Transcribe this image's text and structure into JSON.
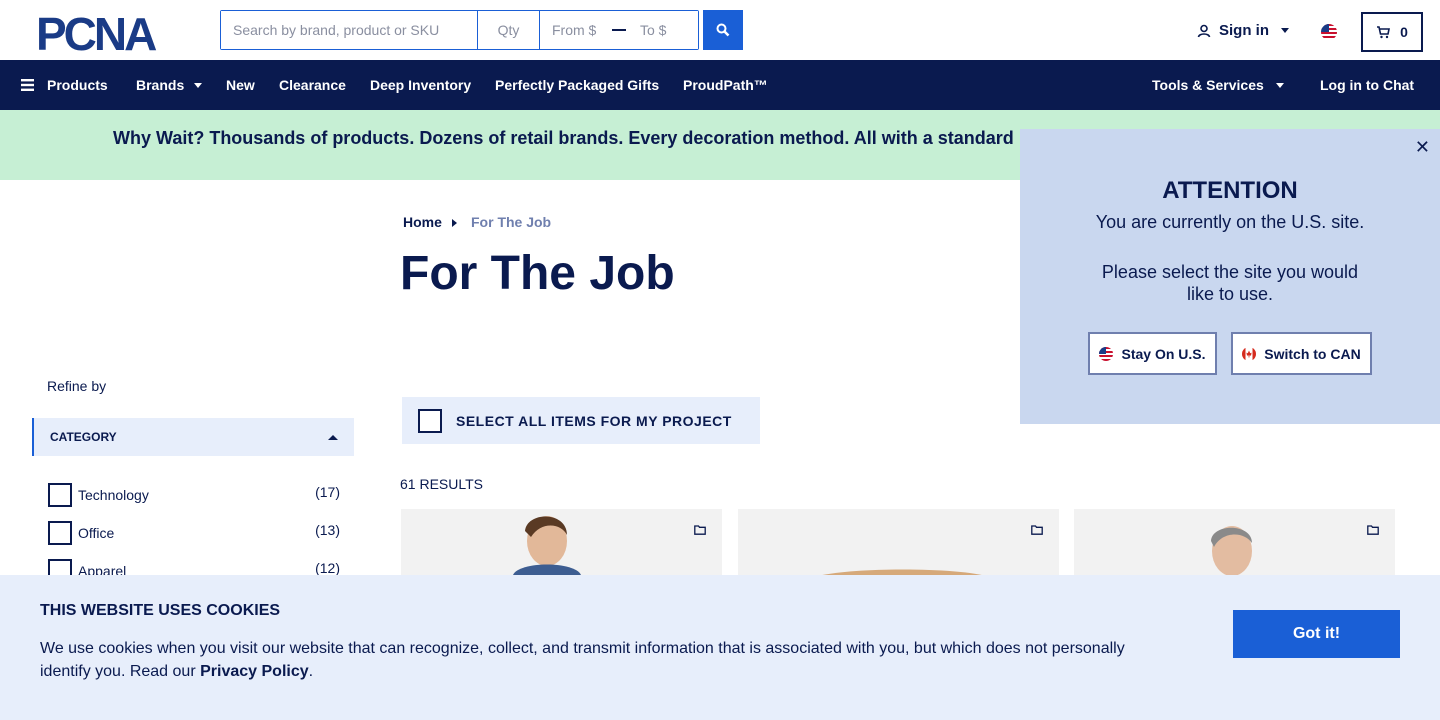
{
  "header": {
    "logo_text": "PCNA",
    "search": {
      "placeholder": "Search by brand, product or SKU",
      "qty_placeholder": "Qty",
      "from_placeholder": "From $",
      "to_placeholder": "To $"
    },
    "signin_label": "Sign in",
    "cart_count": "0"
  },
  "nav": {
    "products": "Products",
    "brands": "Brands",
    "new": "New",
    "clearance": "Clearance",
    "deep_inventory": "Deep Inventory",
    "gifts": "Perfectly Packaged Gifts",
    "proudpath": "ProudPath™",
    "tools": "Tools & Services",
    "chat": "Log in to Chat"
  },
  "promo": {
    "text": "Why Wait? Thousands of products. Dozens of retail brands. Every decoration method. All with a standard"
  },
  "breadcrumb": {
    "home": "Home",
    "current": "For The Job"
  },
  "page_title": "For The Job",
  "sidebar": {
    "refine_label": "Refine by",
    "category_header": "CATEGORY",
    "categories": [
      {
        "label": "Technology",
        "count": "(17)"
      },
      {
        "label": "Office",
        "count": "(13)"
      },
      {
        "label": "Apparel",
        "count": "(12)"
      }
    ]
  },
  "main": {
    "select_all_label": "SELECT ALL ITEMS FOR MY PROJECT",
    "results_label": "61 RESULTS"
  },
  "attention": {
    "title": "ATTENTION",
    "line1": "You are currently on the U.S. site.",
    "line2": "Please select the site you would like to use.",
    "stay_label": "Stay On U.S.",
    "switch_label": "Switch to CAN"
  },
  "cookie": {
    "title": "THIS WEBSITE USES COOKIES",
    "text": "We use cookies when you visit our website that can recognize, collect, and transmit information that is associated with you, but which does not personally identify you. Read our",
    "link": "Privacy Policy",
    "period": ".",
    "button": "Got it!"
  },
  "colors": {
    "navy": "#0a1a4f",
    "blue": "#1a5fd6",
    "promo_green": "#c6efd4",
    "popup_bg": "#c9d7ef"
  }
}
